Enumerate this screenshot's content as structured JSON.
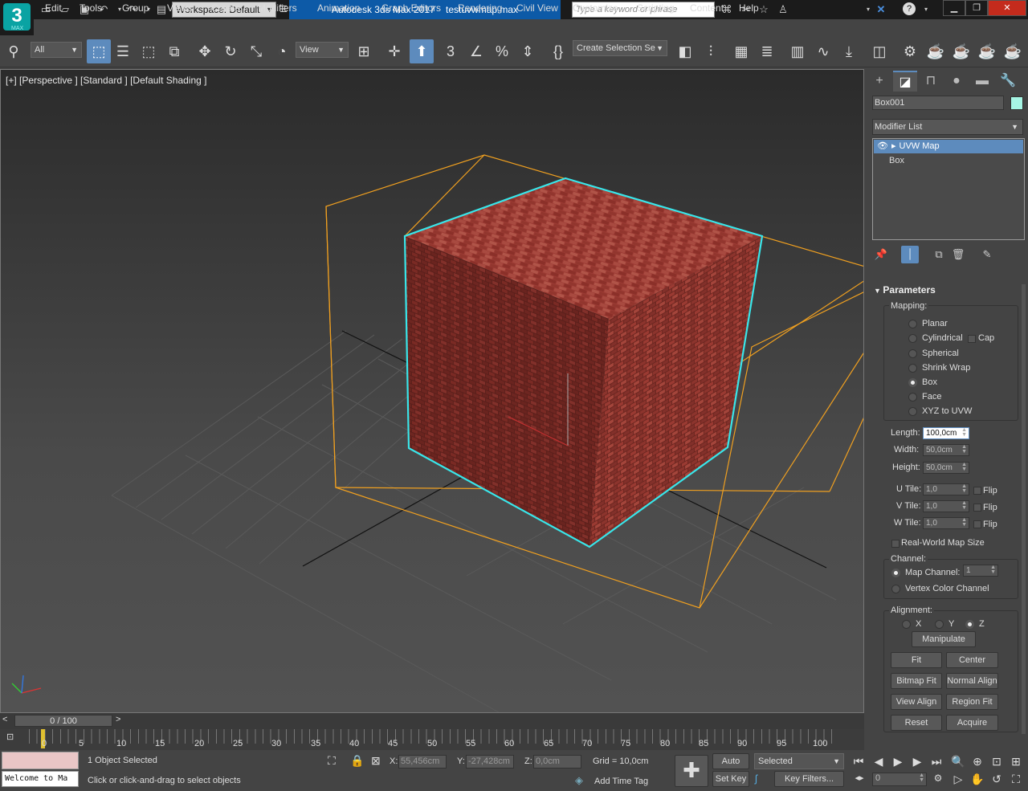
{
  "title": {
    "app": "Autodesk 3ds Max 2017",
    "file": "testuvwmap.max",
    "logo_text": "3",
    "logo_sub": "MAX",
    "workspace": "Workspace: Default",
    "search_placeholder": "Type a keyword or phrase"
  },
  "menu": [
    "Edit",
    "Tools",
    "Group",
    "Views",
    "Create",
    "Modifiers",
    "Animation",
    "Graph Editors",
    "Rendering",
    "Civil View",
    "Customize",
    "Scripting",
    "Content",
    "Help"
  ],
  "toolbar": {
    "filter": "All",
    "refcoord": "View",
    "named_sel": "Create Selection Se"
  },
  "viewport": {
    "label": "[+] [Perspective ] [Standard ] [Default Shading ]"
  },
  "panel": {
    "object_name": "Box001",
    "object_color": "#a6f5e4",
    "modifier_list": "Modifier List",
    "stack": [
      "UVW Map",
      "Box"
    ],
    "rollout": "Parameters",
    "mapping_label": "Mapping:",
    "mapping": [
      "Planar",
      "Cylindrical",
      "Spherical",
      "Shrink Wrap",
      "Box",
      "Face",
      "XYZ to UVW"
    ],
    "mapping_selected": "Box",
    "cap": "Cap",
    "length_label": "Length:",
    "length": "100,0cm",
    "width_label": "Width:",
    "width": "50,0cm",
    "height_label": "Height:",
    "height": "50,0cm",
    "u_tile_label": "U Tile:",
    "u_tile": "1,0",
    "v_tile_label": "V Tile:",
    "v_tile": "1,0",
    "w_tile_label": "W Tile:",
    "w_tile": "1,0",
    "flip": "Flip",
    "realworld": "Real-World Map Size",
    "channel_label": "Channel:",
    "map_channel": "Map Channel:",
    "map_channel_value": "1",
    "vertex_color": "Vertex Color Channel",
    "alignment_label": "Alignment:",
    "align_x": "X",
    "align_y": "Y",
    "align_z": "Z",
    "align_selected": "Z",
    "buttons": {
      "manipulate": "Manipulate",
      "fit": "Fit",
      "center": "Center",
      "bitmap_fit": "Bitmap Fit",
      "normal_align": "Normal Align",
      "view_align": "View Align",
      "region_fit": "Region Fit",
      "reset": "Reset",
      "acquire": "Acquire"
    }
  },
  "timeline": {
    "frame": "0 / 100",
    "ticks": [
      "0",
      "5",
      "10",
      "15",
      "20",
      "25",
      "30",
      "35",
      "40",
      "45",
      "50",
      "55",
      "60",
      "65",
      "70",
      "75",
      "80",
      "85",
      "90",
      "95",
      "100"
    ]
  },
  "status": {
    "selected": "1 Object Selected",
    "prompt": "Click or click-and-drag to select objects",
    "maxscript": "Welcome to Ma",
    "x_label": "X:",
    "x": "55,456cm",
    "y_label": "Y:",
    "y": "-27,428cm",
    "z_label": "Z:",
    "z": "0,0cm",
    "grid": "Grid = 10,0cm",
    "add_time_tag": "Add Time Tag",
    "auto_key": "Auto Key",
    "set_key": "Set Key",
    "selected_dropdown": "Selected",
    "key_filters": "Key Filters...",
    "frame_field": "0"
  }
}
